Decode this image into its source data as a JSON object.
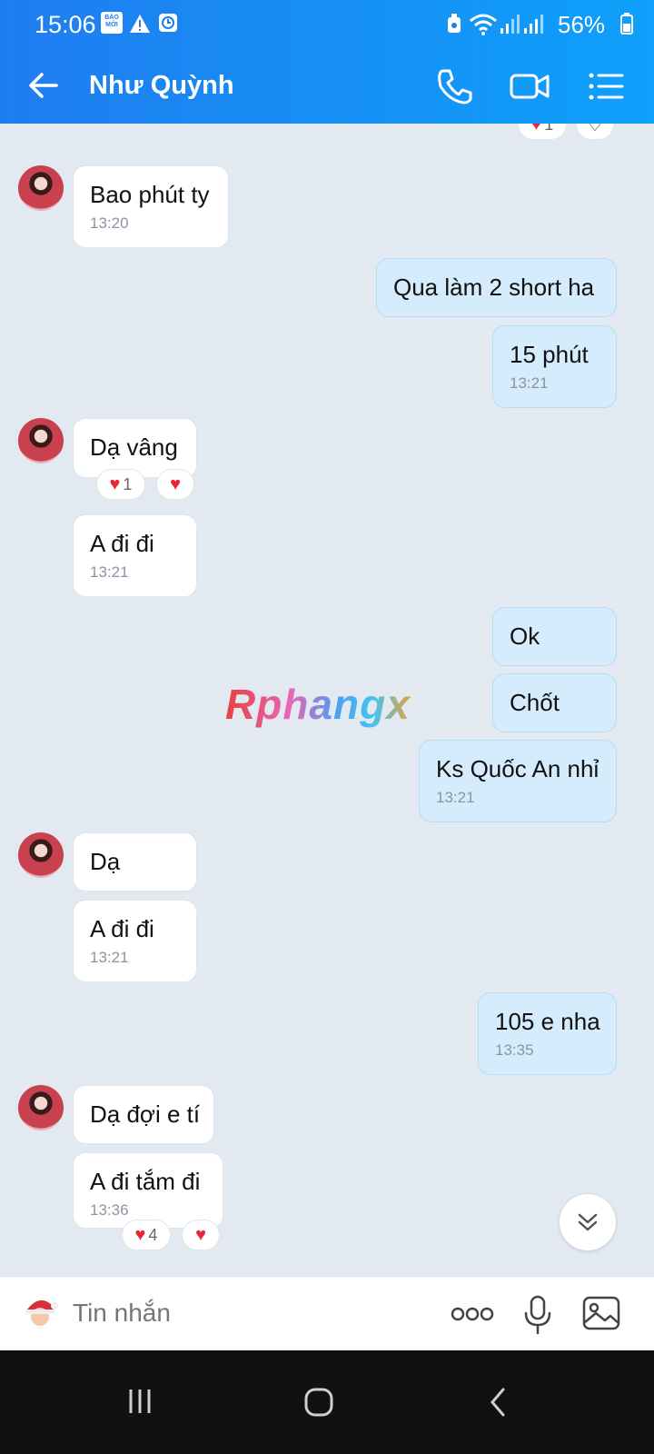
{
  "status_bar": {
    "time": "15:06",
    "battery": "56%",
    "news_badge": "BÁO MỚI"
  },
  "header": {
    "title": "Như Quỳnh"
  },
  "watermark": "Rphangx",
  "messages": [
    {
      "text": "Bao phút ty",
      "time": "13:20"
    },
    {
      "text": "Qua làm 2 short ha",
      "time": ""
    },
    {
      "text": "15 phút",
      "time": "13:21"
    },
    {
      "text": "Dạ vâng",
      "time": "",
      "reaction_count": "1"
    },
    {
      "text": "A đi đi",
      "time": "13:21"
    },
    {
      "text": "Ok",
      "time": ""
    },
    {
      "text": "Chốt",
      "time": ""
    },
    {
      "text": "Ks Quốc An nhỉ",
      "time": "13:21"
    },
    {
      "text": "Dạ",
      "time": ""
    },
    {
      "text": "A đi đi",
      "time": "13:21"
    },
    {
      "text": "105 e nha",
      "time": "13:35"
    },
    {
      "text": "Dạ đợi e tí",
      "time": ""
    },
    {
      "text": "A đi tắm đi",
      "time": "13:36",
      "reaction_count": "4"
    }
  ],
  "top_partial_reaction_count": "1",
  "input": {
    "placeholder": "Tin nhắn"
  },
  "colors": {
    "header_start": "#1f7df0",
    "header_end": "#0ea0fa",
    "outgoing_bubble": "#d5ecfd",
    "incoming_bubble": "#ffffff",
    "heart": "#e8263a"
  }
}
